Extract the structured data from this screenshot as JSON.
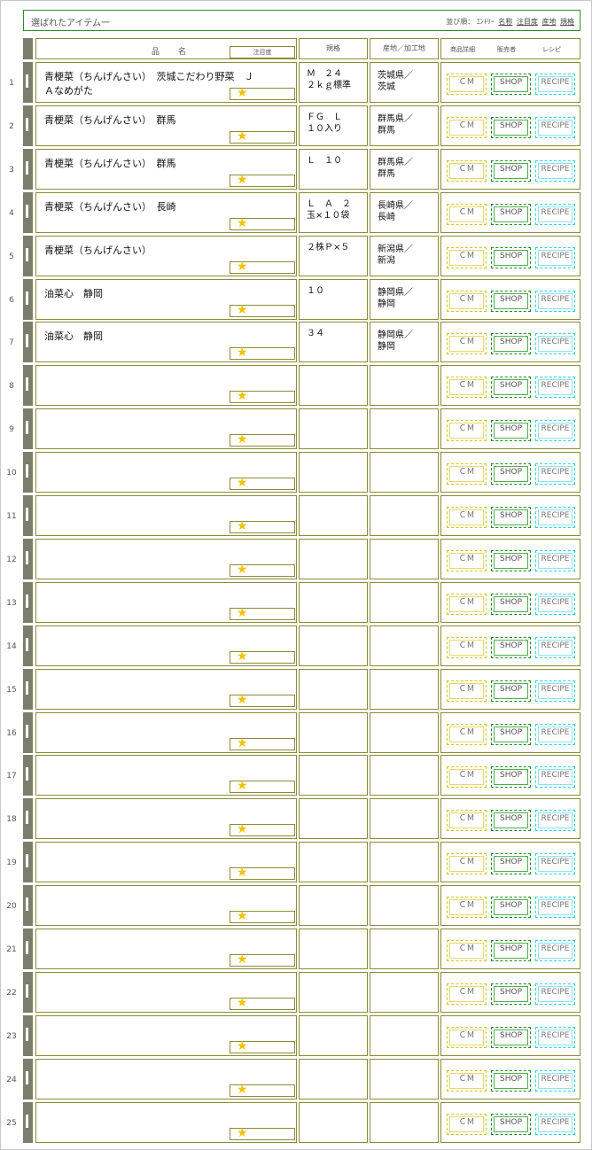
{
  "title": "選ばれたアイテム一",
  "sort": {
    "prefix": "並び順：",
    "entry": "ｴﾝﾄﾘｰ",
    "links": [
      "名称",
      "注目度",
      "産地",
      "規格"
    ]
  },
  "header": {
    "name": "品　名",
    "attention": "注目度",
    "spec": "規格",
    "origin": "産地／加工地",
    "detail": "商品詳細",
    "seller": "販売者",
    "recipe": "レシピ"
  },
  "buttons": {
    "cm": "ＣＭ",
    "shop": "SHOP",
    "recipe": "RECIPE"
  },
  "star_glyph": "★",
  "rows": [
    {
      "num": "1",
      "name": "青梗菜（ちんげんさい）　茨城こだわり野菜　Ｊ\nＡなめがた",
      "spec": "Ｍ　２４\n２ｋｇ標準",
      "origin": "茨城県／\n茨城"
    },
    {
      "num": "2",
      "name": "青梗菜（ちんげんさい）　群馬",
      "spec": "ＦＧ　Ｌ\n１０入り",
      "origin": "群馬県／\n群馬"
    },
    {
      "num": "3",
      "name": "青梗菜（ちんげんさい）　群馬",
      "spec": "Ｌ　１０",
      "origin": "群馬県／\n群馬"
    },
    {
      "num": "4",
      "name": "青梗菜（ちんげんさい）　長崎",
      "spec": "Ｌ　Ａ　２\n玉×１０袋",
      "origin": "長崎県／\n長崎"
    },
    {
      "num": "5",
      "name": "青梗菜（ちんげんさい）",
      "spec": "２株Ｐ×５",
      "origin": "新潟県／\n新潟"
    },
    {
      "num": "6",
      "name": "油菜心　静岡",
      "spec": "１０",
      "origin": "静岡県／\n静岡"
    },
    {
      "num": "7",
      "name": "油菜心　静岡",
      "spec": "３４",
      "origin": "静岡県／\n静岡"
    },
    {
      "num": "8",
      "name": "",
      "spec": "",
      "origin": ""
    },
    {
      "num": "9",
      "name": "",
      "spec": "",
      "origin": ""
    },
    {
      "num": "10",
      "name": "",
      "spec": "",
      "origin": ""
    },
    {
      "num": "11",
      "name": "",
      "spec": "",
      "origin": ""
    },
    {
      "num": "12",
      "name": "",
      "spec": "",
      "origin": ""
    },
    {
      "num": "13",
      "name": "",
      "spec": "",
      "origin": ""
    },
    {
      "num": "14",
      "name": "",
      "spec": "",
      "origin": ""
    },
    {
      "num": "15",
      "name": "",
      "spec": "",
      "origin": ""
    },
    {
      "num": "16",
      "name": "",
      "spec": "",
      "origin": ""
    },
    {
      "num": "17",
      "name": "",
      "spec": "",
      "origin": ""
    },
    {
      "num": "18",
      "name": "",
      "spec": "",
      "origin": ""
    },
    {
      "num": "19",
      "name": "",
      "spec": "",
      "origin": ""
    },
    {
      "num": "20",
      "name": "",
      "spec": "",
      "origin": ""
    },
    {
      "num": "21",
      "name": "",
      "spec": "",
      "origin": ""
    },
    {
      "num": "22",
      "name": "",
      "spec": "",
      "origin": ""
    },
    {
      "num": "23",
      "name": "",
      "spec": "",
      "origin": ""
    },
    {
      "num": "24",
      "name": "",
      "spec": "",
      "origin": ""
    },
    {
      "num": "25",
      "name": "",
      "spec": "",
      "origin": ""
    }
  ]
}
